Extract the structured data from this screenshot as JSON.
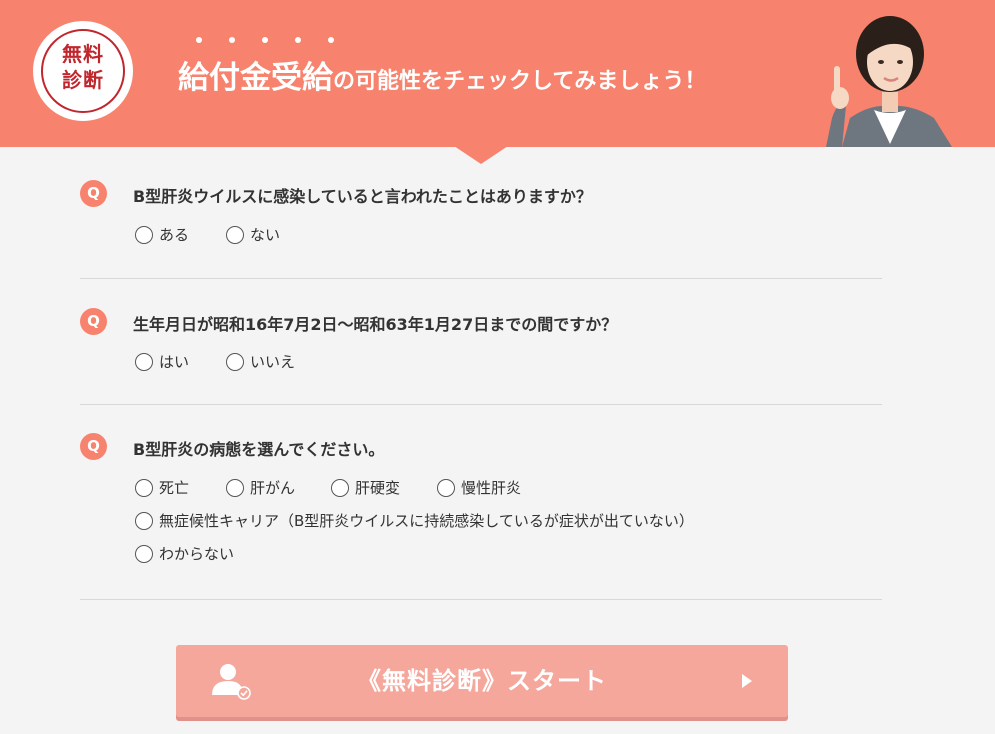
{
  "header": {
    "badge_line1": "無料",
    "badge_line2": "診断",
    "headline_big": "給付金受給",
    "headline_rest": "の可能性をチェックしてみましょう！"
  },
  "questions": [
    {
      "icon": "Q",
      "text": "B型肝炎ウイルスに感染していると言われたことはありますか？",
      "options": [
        "ある",
        "ない"
      ]
    },
    {
      "icon": "Q",
      "text": "生年月日が昭和16年7月2日～昭和63年1月27日までの間ですか？",
      "options": [
        "はい",
        "いいえ"
      ]
    },
    {
      "icon": "Q",
      "text": "B型肝炎の病態を選んでください。",
      "options": [
        "死亡",
        "肝がん",
        "肝硬変",
        "慢性肝炎",
        "無症候性キャリア（B型肝炎ウイルスに持続感染しているが症状が出ていない）",
        "わからない"
      ]
    }
  ],
  "start_button": {
    "label": "《無料診断》スタート"
  },
  "colors": {
    "accent": "#f7836e",
    "badge_red": "#c0272d",
    "button": "#f5a79c"
  }
}
